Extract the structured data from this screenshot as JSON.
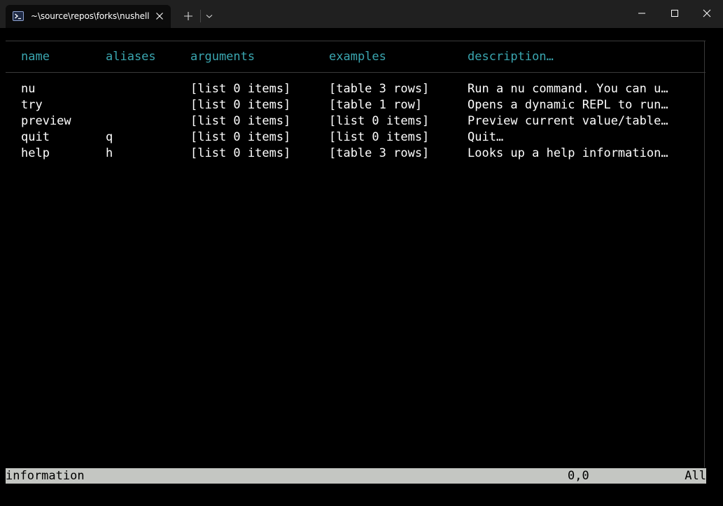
{
  "window": {
    "tab_title": "~\\source\\repos\\forks\\nushell",
    "tab_icon": "powershell-icon"
  },
  "table": {
    "headers": {
      "name": "name",
      "aliases": "aliases",
      "arguments": "arguments",
      "examples": "examples",
      "description": "description…"
    },
    "rows": [
      {
        "name": "nu",
        "aliases": "",
        "arguments": "[list 0 items]",
        "examples": "[table 3 rows]",
        "description": "Run a nu command. You can u…"
      },
      {
        "name": "try",
        "aliases": "",
        "arguments": "[list 0 items]",
        "examples": "[table 1 row]",
        "description": "Opens a dynamic REPL to run…"
      },
      {
        "name": "preview",
        "aliases": "",
        "arguments": "[list 0 items]",
        "examples": "[list 0 items]",
        "description": "Preview current value/table…"
      },
      {
        "name": "quit",
        "aliases": "q",
        "arguments": "[list 0 items]",
        "examples": "[list 0 items]",
        "description": "Quit…"
      },
      {
        "name": "help",
        "aliases": "h",
        "arguments": "[list 0 items]",
        "examples": "[table 3 rows]",
        "description": "Looks up a help information…"
      }
    ]
  },
  "status": {
    "mode": "information",
    "cursor": "0,0",
    "scroll": "All"
  },
  "colors": {
    "header": "#3aa6b0",
    "background": "#000000",
    "statusbar": "#c4c6c2"
  }
}
